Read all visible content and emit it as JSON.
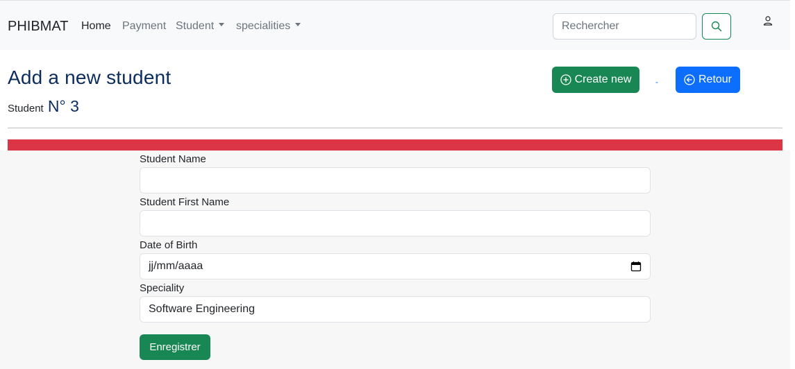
{
  "navbar": {
    "brand": "PHIBMAT",
    "links": [
      {
        "label": "Home"
      },
      {
        "label": "Payment"
      },
      {
        "label": "Student"
      },
      {
        "label": "specialities"
      }
    ],
    "search_placeholder": "Rechercher"
  },
  "header": {
    "title": "Add a new student",
    "student_label": "Student",
    "student_number": "N° 3",
    "create_label": "Create new",
    "separator": "-",
    "back_label": "Retour"
  },
  "form": {
    "name_label": "Student Name",
    "name_value": "",
    "first_name_label": "Student First Name",
    "first_name_value": "",
    "dob_label": "Date of Birth",
    "dob_placeholder": "jj/mm/aaaa",
    "speciality_label": "Speciality",
    "speciality_value": "Software Engineering",
    "submit_label": "Enregistrer"
  },
  "colors": {
    "primary": "#0d6efd",
    "success": "#198754",
    "danger": "#dc3545",
    "title": "#0b2d5e"
  }
}
